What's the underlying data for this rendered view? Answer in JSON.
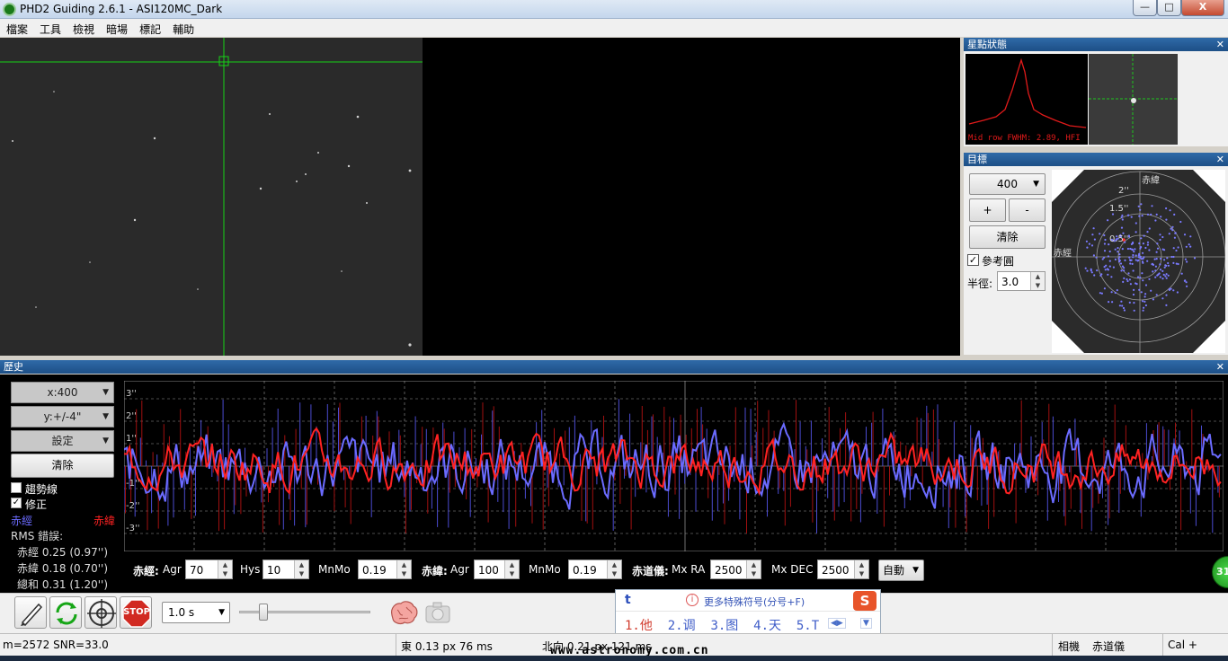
{
  "window": {
    "title": "PHD2 Guiding 2.6.1 - ASI120MC_Dark",
    "minimize": "—",
    "maximize": "□",
    "close": "X"
  },
  "menu": [
    "檔案",
    "工具",
    "檢視",
    "暗場",
    "標記",
    "輔助"
  ],
  "star_profile": {
    "title": "星點狀態",
    "caption": "Mid row FWHM: 2.89, HFI"
  },
  "target": {
    "title": "目標",
    "scale_value": "400",
    "plus": "+",
    "minus": "-",
    "clear": "清除",
    "ref_circle_label": "參考圓",
    "ref_circle_checked": true,
    "radius_label": "半徑:",
    "radius_value": "3.0",
    "ring_labels": [
      "2''",
      "1.5''",
      "0.5''"
    ],
    "axis_dec": "赤緯",
    "axis_ra": "赤經"
  },
  "history": {
    "title": "歷史",
    "x_scale": "x:400",
    "y_scale": "y:+/-4\"",
    "settings": "設定",
    "clear": "清除",
    "trendline_label": "趨勢線",
    "trendline_checked": false,
    "correction_label": "修正",
    "correction_checked": true,
    "ra_legend": "赤經",
    "dec_legend": "赤緯",
    "rms_title": "RMS 錯誤:",
    "rms_ra": "赤經 0.25 (0.97'')",
    "rms_dec": "赤緯 0.18 (0.70'')",
    "rms_total": "總和 0.31 (1.20'')",
    "y_ticks": [
      "3''",
      "2''",
      "1''",
      "-1''",
      "-2''",
      "-3''"
    ],
    "colors": {
      "ra": "#6b6bff",
      "dec": "#ff2222"
    }
  },
  "params": {
    "ra_label": "赤經:",
    "agr_label": "Agr",
    "ra_agr": "70",
    "hys_label": "Hys",
    "ra_hys": "10",
    "mnmo_label": "MnMo",
    "ra_mnmo": "0.19",
    "dec_label": "赤緯:",
    "dec_agr_label": "Agr",
    "dec_agr": "100",
    "dec_mnmo_label": "MnMo",
    "dec_mnmo": "0.19",
    "mount_label": "赤道儀:",
    "mxra_label": "Mx RA",
    "mxra": "2500",
    "mxdec_label": "Mx DEC",
    "mxdec": "2500",
    "mode": "自動"
  },
  "toolbar": {
    "exposure": "1.0 s",
    "stop_label": "STOP"
  },
  "ime": {
    "input": "t",
    "hint": "更多特殊符号(分号+F)",
    "candidates": [
      "1.他",
      "2.调",
      "3.图",
      "4.天",
      "5.T"
    ],
    "logo": "S"
  },
  "status": {
    "star_info": "m=2572 SNR=33.0",
    "east": "東 0.13 px 76 ms",
    "north": "北向 0.21 px 121 ms",
    "camera": "相機",
    "mount": "赤道儀",
    "cal": "Cal +"
  },
  "watermark": "www.astronomy.com.cn",
  "edge_badge": "31"
}
